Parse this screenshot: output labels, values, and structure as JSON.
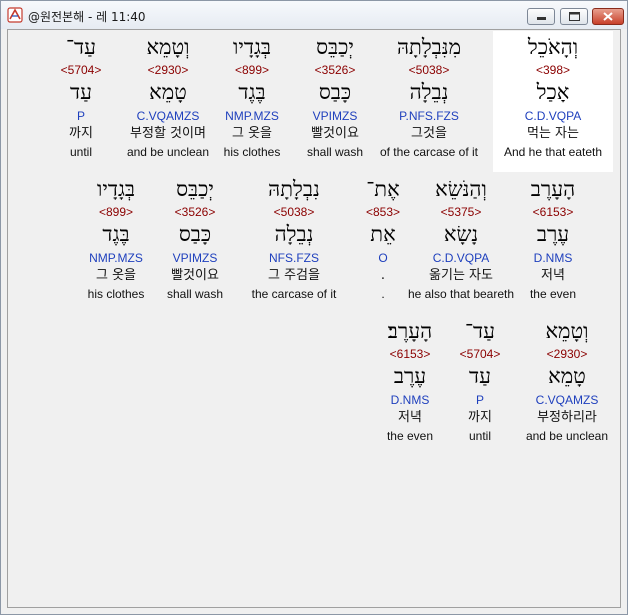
{
  "window": {
    "title": "@원전본해 - 레 11:40",
    "icon": "app-icon"
  },
  "rows": [
    [
      {
        "heb": "וְהָאֹכֵל",
        "num": "<398>",
        "lex": "אָכַל",
        "parse": "C.D.VQPA",
        "kor": "먹는 자는",
        "eng": "And he that eateth",
        "selected": true
      },
      {
        "heb": "מִנִּבְלָתָהּ",
        "num": "<5038>",
        "lex": "נְבֵלָה",
        "parse": "P.NFS.FZS",
        "kor": "그것을",
        "eng": "of the carcase of it"
      },
      {
        "heb": "יְכַבֵּס",
        "num": "<3526>",
        "lex": "כָּבַס",
        "parse": "VPIMZS",
        "kor": "빨것이요",
        "eng": "shall wash"
      },
      {
        "heb": "בְּגָדָיו",
        "num": "<899>",
        "lex": "בֶּגֶד",
        "parse": "NMP.MZS",
        "kor": "그 옷을",
        "eng": "his clothes"
      },
      {
        "heb": "וְטָמֵא",
        "num": "<2930>",
        "lex": "טָמֵא",
        "parse": "C.VQAMZS",
        "kor": "부정할 것이며",
        "eng": "and be unclean"
      },
      {
        "heb": "עַד־",
        "num": "<5704>",
        "lex": "עַד",
        "parse": "P",
        "kor": "까지",
        "eng": "until"
      }
    ],
    [
      {
        "heb": "הָעָרֶב",
        "num": "<6153>",
        "lex": "עֶרֶב",
        "parse": "D.NMS",
        "kor": "저녁",
        "eng": "the even"
      },
      {
        "heb": "וְהַנֹּשֵׂא",
        "num": "<5375>",
        "lex": "נָשָׂא",
        "parse": "C.D.VQPA",
        "kor": "옮기는 자도",
        "eng": "he also that beareth"
      },
      {
        "heb": "אֶת־",
        "num": "<853>",
        "lex": "אֵת",
        "parse": "O",
        "kor": ".",
        "eng": "."
      },
      {
        "heb": "נִבְלָתָהּ",
        "num": "<5038>",
        "lex": "נְבֵלָה",
        "parse": "NFS.FZS",
        "kor": "그 주검을",
        "eng": "the carcase of it"
      },
      {
        "heb": "יְכַבֵּס",
        "num": "<3526>",
        "lex": "כָּבַס",
        "parse": "VPIMZS",
        "kor": "빨것이요",
        "eng": "shall wash"
      },
      {
        "heb": "בְּגָדָיו",
        "num": "<899>",
        "lex": "בֶּגֶד",
        "parse": "NMP.MZS",
        "kor": "그 옷을",
        "eng": "his clothes"
      }
    ],
    [
      {
        "heb": "וְטָמֵא",
        "num": "<2930>",
        "lex": "טָמֵא",
        "parse": "C.VQAMZS",
        "kor": "부정하리라",
        "eng": "and be unclean"
      },
      {
        "heb": "עַד־",
        "num": "<5704>",
        "lex": "עַד",
        "parse": "P",
        "kor": "까지",
        "eng": "until"
      },
      {
        "heb": "הָעָרֶב׃",
        "num": "<6153>",
        "lex": "עֶרֶב",
        "parse": "D.NMS",
        "kor": "저녁",
        "eng": "the even"
      }
    ]
  ]
}
